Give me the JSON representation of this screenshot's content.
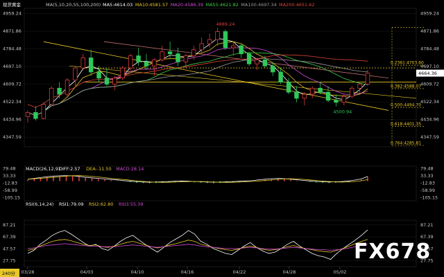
{
  "chart_data": [
    {
      "type": "candlestick",
      "title": "现货黄金",
      "period": "240分",
      "ma_header": "MA(5,10,20,55,100,200)",
      "ma_legend": [
        {
          "label": "MA5:4614.03",
          "color": "#ffffff"
        },
        {
          "label": "MA10:4581.57",
          "color": "#e8c82a"
        },
        {
          "label": "MA20:4586.39",
          "color": "#d24bd6"
        },
        {
          "label": "MA55:4621.82",
          "color": "#3fd14a"
        },
        {
          "label": "MA100:4697.34",
          "color": "#9b9b9b"
        },
        {
          "label": "MA200:4651.62",
          "color": "#e0453a"
        }
      ],
      "y_ticks": [
        4959.24,
        4871.86,
        4784.48,
        4697.1,
        4609.72,
        4522.34,
        4434.96,
        4347.59
      ],
      "ylim": [
        4300,
        4985
      ],
      "x_ticks": [
        "03/28",
        "04/03",
        "04/10",
        "04/16",
        "04/22",
        "04/28",
        "05/02"
      ],
      "last_price": "4664.36",
      "annotations": {
        "high": "4889.24",
        "low": "4500.94"
      },
      "fib_levels": [
        {
          "label": "0.2361:4703.60",
          "value": 4703.6
        },
        {
          "label": "0.382:4588.07",
          "value": 4588.07
        },
        {
          "label": "0.500:4494.70",
          "value": 4494.7
        },
        {
          "label": "0.618:4401.35",
          "value": 4401.35
        },
        {
          "label": "0.764:4285.81",
          "value": 4285.81
        }
      ],
      "fib_top": 4890,
      "horizontal_levels": [
        4690,
        4620
      ],
      "candles_approx": [
        [
          4450,
          4480,
          4420,
          4470
        ],
        [
          4470,
          4500,
          4430,
          4440
        ],
        [
          4440,
          4520,
          4435,
          4510
        ],
        [
          4510,
          4600,
          4500,
          4590
        ],
        [
          4590,
          4620,
          4540,
          4560
        ],
        [
          4560,
          4640,
          4550,
          4630
        ],
        [
          4630,
          4700,
          4600,
          4690
        ],
        [
          4690,
          4760,
          4680,
          4740
        ],
        [
          4740,
          4780,
          4650,
          4670
        ],
        [
          4670,
          4700,
          4620,
          4640
        ],
        [
          4640,
          4690,
          4600,
          4610
        ],
        [
          4610,
          4650,
          4580,
          4640
        ],
        [
          4640,
          4700,
          4630,
          4690
        ],
        [
          4690,
          4760,
          4680,
          4750
        ],
        [
          4750,
          4790,
          4700,
          4720
        ],
        [
          4720,
          4760,
          4680,
          4700
        ],
        [
          4700,
          4740,
          4650,
          4730
        ],
        [
          4730,
          4800,
          4720,
          4770
        ],
        [
          4770,
          4820,
          4740,
          4760
        ],
        [
          4760,
          4790,
          4700,
          4720
        ],
        [
          4720,
          4760,
          4690,
          4750
        ],
        [
          4750,
          4800,
          4730,
          4780
        ],
        [
          4780,
          4840,
          4760,
          4810
        ],
        [
          4810,
          4860,
          4790,
          4830
        ],
        [
          4830,
          4889,
          4800,
          4870
        ],
        [
          4870,
          4880,
          4780,
          4790
        ],
        [
          4790,
          4820,
          4750,
          4800
        ],
        [
          4800,
          4810,
          4740,
          4760
        ],
        [
          4760,
          4770,
          4700,
          4710
        ],
        [
          4710,
          4740,
          4680,
          4730
        ],
        [
          4730,
          4750,
          4690,
          4700
        ],
        [
          4700,
          4720,
          4650,
          4670
        ],
        [
          4670,
          4690,
          4610,
          4620
        ],
        [
          4620,
          4640,
          4560,
          4570
        ],
        [
          4570,
          4600,
          4520,
          4540
        ],
        [
          4540,
          4570,
          4505,
          4560
        ],
        [
          4560,
          4600,
          4540,
          4590
        ],
        [
          4590,
          4620,
          4560,
          4570
        ],
        [
          4570,
          4600,
          4520,
          4530
        ],
        [
          4530,
          4560,
          4501,
          4520
        ],
        [
          4520,
          4560,
          4505,
          4550
        ],
        [
          4550,
          4600,
          4540,
          4590
        ],
        [
          4590,
          4620,
          4570,
          4610
        ],
        [
          4610,
          4680,
          4600,
          4664
        ]
      ]
    },
    {
      "type": "bar",
      "title": "MACD(26,12,9)",
      "legend": [
        {
          "label": "DIFF:2.57",
          "color": "#ffffff"
        },
        {
          "label": "DEA:-11.50",
          "color": "#e8c82a"
        },
        {
          "label": "MACD:28.14",
          "color": "#d24bd6"
        }
      ],
      "y_ticks": [
        79.48,
        33.33,
        -12.83,
        -58.99,
        -105.15
      ],
      "ylim": [
        -125,
        95
      ],
      "hist_approx": [
        8,
        14,
        20,
        26,
        30,
        32,
        33,
        32,
        28,
        22,
        18,
        14,
        10,
        6,
        3,
        -2,
        -6,
        -10,
        -12,
        -13,
        -12,
        -10,
        -8,
        -6,
        -4,
        -6,
        -8,
        -10,
        -12,
        -13,
        -12,
        -10,
        -8,
        -6,
        -4,
        -2,
        4,
        8,
        12,
        14,
        12,
        8,
        4,
        0,
        -4,
        -8,
        -10,
        -12,
        -10,
        -8,
        -4,
        2,
        10,
        28
      ]
    },
    {
      "type": "line",
      "title": "RSI(6,14,24)",
      "legend": [
        {
          "label": "RSI1:79.09",
          "color": "#ffffff"
        },
        {
          "label": "RSI2:62.80",
          "color": "#e8c82a"
        },
        {
          "label": "RSI3:55.39",
          "color": "#d24bd6"
        }
      ],
      "y_ticks": [
        87.21,
        67.39,
        47.57,
        27.75
      ],
      "ylim": [
        18,
        95
      ],
      "series_approx": [
        [
          40,
          45,
          55,
          62,
          70,
          75,
          78,
          72,
          65,
          58,
          52,
          55,
          48,
          45,
          52,
          60,
          66,
          70,
          62,
          55,
          48,
          42,
          50,
          58,
          64,
          70,
          78,
          72,
          60,
          55,
          48,
          44,
          40,
          38,
          45,
          52,
          58,
          50,
          44,
          40,
          42,
          48,
          55,
          60,
          52,
          46,
          40,
          36,
          34,
          30,
          40,
          48,
          55,
          62,
          70,
          79
        ],
        [
          45,
          47,
          52,
          56,
          60,
          62,
          63,
          61,
          58,
          55,
          53,
          54,
          51,
          50,
          52,
          55,
          58,
          60,
          57,
          54,
          51,
          49,
          51,
          54,
          56,
          59,
          62,
          60,
          55,
          53,
          50,
          48,
          46,
          45,
          47,
          50,
          52,
          50,
          47,
          45,
          46,
          48,
          51,
          53,
          50,
          48,
          46,
          44,
          43,
          42,
          45,
          48,
          52,
          56,
          60,
          63
        ],
        [
          48,
          49,
          51,
          53,
          54,
          55,
          56,
          55,
          54,
          53,
          52,
          52,
          51,
          51,
          51,
          52,
          53,
          54,
          53,
          52,
          51,
          50,
          51,
          52,
          53,
          54,
          55,
          54,
          52,
          51,
          50,
          49,
          48,
          48,
          48,
          49,
          50,
          49,
          48,
          47,
          47,
          48,
          49,
          50,
          49,
          48,
          47,
          46,
          46,
          45,
          46,
          47,
          49,
          51,
          53,
          55
        ]
      ]
    }
  ],
  "watermark": "FX678"
}
